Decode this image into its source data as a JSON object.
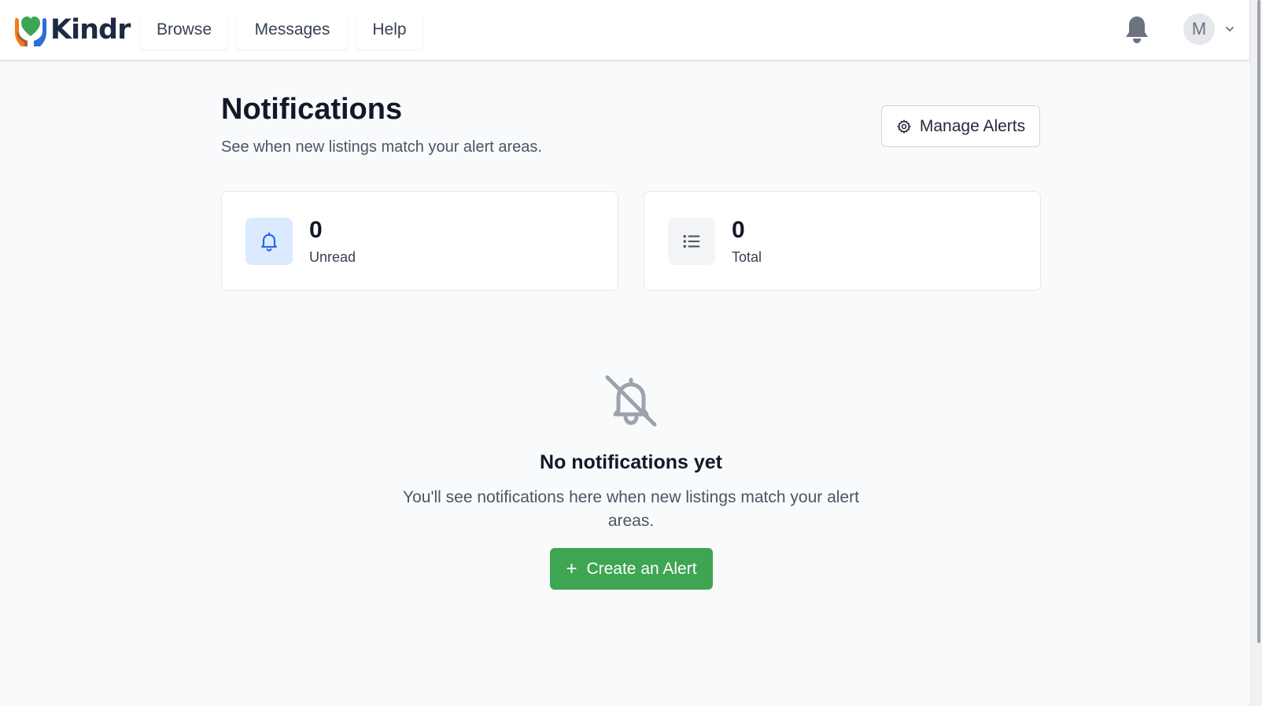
{
  "brand": {
    "name": "Kindr"
  },
  "nav": {
    "items": [
      {
        "label": "Browse"
      },
      {
        "label": "Messages"
      },
      {
        "label": "Help"
      }
    ]
  },
  "user": {
    "initial": "M"
  },
  "page": {
    "title": "Notifications",
    "subtitle": "See when new listings match your alert areas.",
    "manage_alerts_label": "Manage Alerts"
  },
  "stats": [
    {
      "value": "0",
      "label": "Unread",
      "icon": "bell-icon"
    },
    {
      "value": "0",
      "label": "Total",
      "icon": "list-icon"
    }
  ],
  "empty_state": {
    "icon": "bell-off-icon",
    "title": "No notifications yet",
    "text": "You'll see notifications here when new listings match your alert areas.",
    "cta_label": "Create an Alert",
    "cta_icon": "plus-icon"
  },
  "colors": {
    "accent_green": "#3ea553",
    "unread_icon_bg": "#dbeafe",
    "unread_icon_color": "#2563eb",
    "total_icon_bg": "#f3f4f6",
    "page_bg": "#f9fafb"
  }
}
